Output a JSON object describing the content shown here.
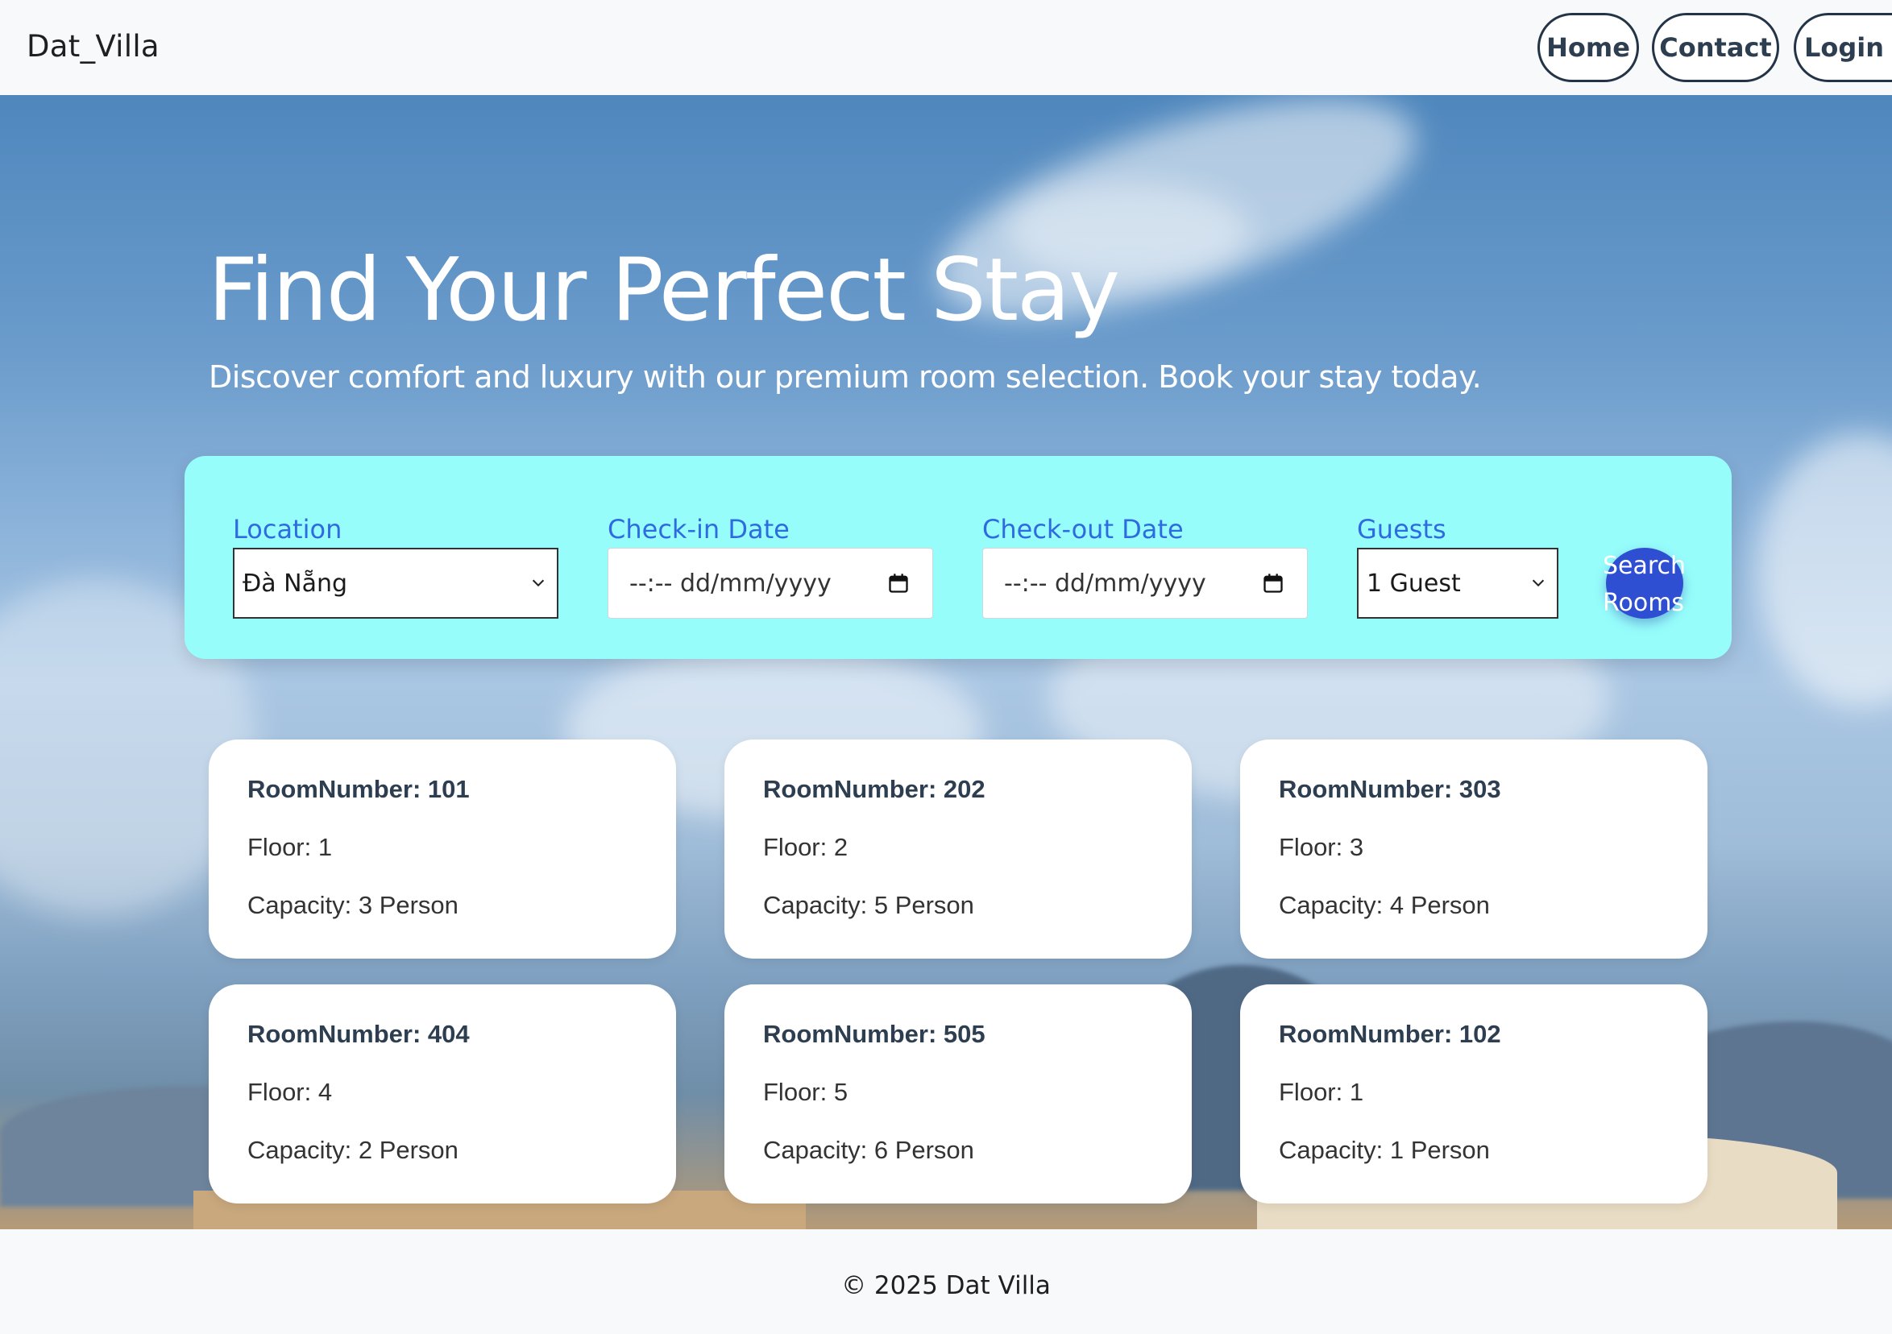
{
  "navbar": {
    "brand": "Dat_Villa",
    "links": [
      "Home",
      "Contact",
      "Login"
    ]
  },
  "hero": {
    "title": "Find Your Perfect Stay",
    "subtitle": "Discover comfort and luxury with our premium room selection. Book your stay today."
  },
  "search": {
    "location_label": "Location",
    "location_value": "Đà Nẵng",
    "checkin_label": "Check-in Date",
    "checkin_placeholder": "--:-- dd/mm/yyyy",
    "checkout_label": "Check-out Date",
    "checkout_placeholder": "--:-- dd/mm/yyyy",
    "guests_label": "Guests",
    "guests_value": "1 Guest",
    "button_line1": "Search",
    "button_line2": "Rooms",
    "colors": {
      "panel": "#97fdfb",
      "label": "#2f6be0",
      "button": "#2f4fd3"
    }
  },
  "rooms": [
    {
      "number": "RoomNumber: 101",
      "floor": "Floor: 1",
      "capacity": "Capacity: 3 Person"
    },
    {
      "number": "RoomNumber: 202",
      "floor": "Floor: 2",
      "capacity": "Capacity: 5 Person"
    },
    {
      "number": "RoomNumber: 303",
      "floor": "Floor: 3",
      "capacity": "Capacity: 4 Person"
    },
    {
      "number": "RoomNumber: 404",
      "floor": "Floor: 4",
      "capacity": "Capacity: 2 Person"
    },
    {
      "number": "RoomNumber: 505",
      "floor": "Floor: 5",
      "capacity": "Capacity: 6 Person"
    },
    {
      "number": "RoomNumber: 102",
      "floor": "Floor: 1",
      "capacity": "Capacity: 1 Person"
    }
  ],
  "footer": {
    "text": "© 2025 Dat Villa"
  },
  "icons": [
    "chevron-down-icon",
    "calendar-icon"
  ]
}
